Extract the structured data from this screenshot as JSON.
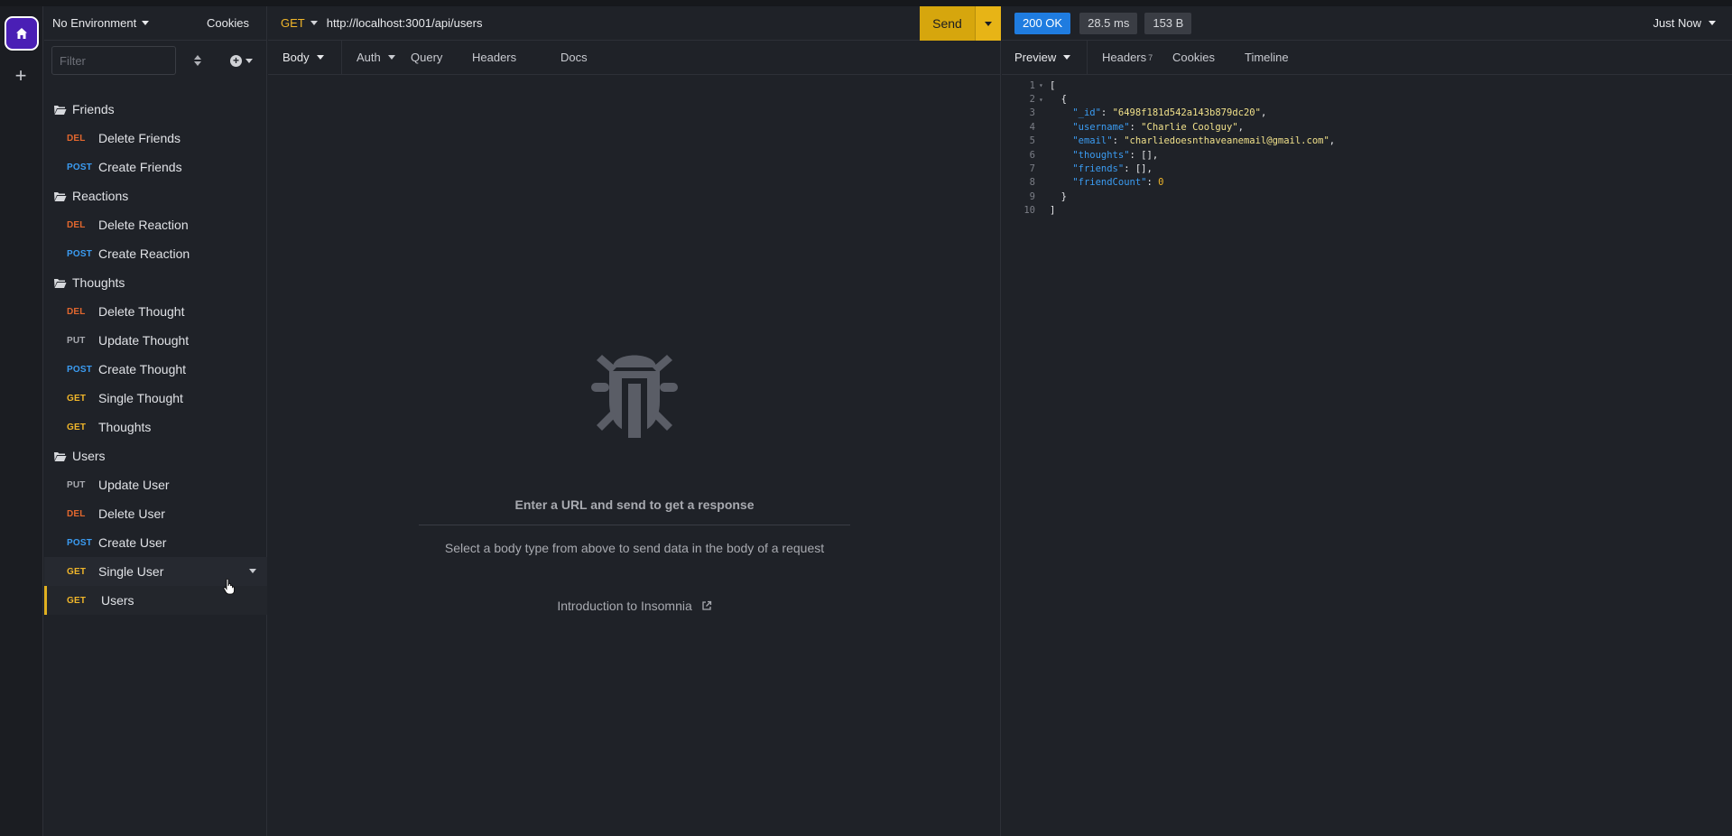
{
  "rail": {
    "home_icon": "home-icon",
    "add_label": "+"
  },
  "sidebar": {
    "environment": "No Environment",
    "cookies": "Cookies",
    "filter_placeholder": "Filter",
    "folders": [
      {
        "name": "Friends",
        "requests": [
          {
            "method": "DEL",
            "name": "Delete Friends"
          },
          {
            "method": "POST",
            "name": "Create Friends"
          }
        ]
      },
      {
        "name": "Reactions",
        "requests": [
          {
            "method": "DEL",
            "name": "Delete Reaction"
          },
          {
            "method": "POST",
            "name": "Create Reaction"
          }
        ]
      },
      {
        "name": "Thoughts",
        "requests": [
          {
            "method": "DEL",
            "name": "Delete Thought"
          },
          {
            "method": "PUT",
            "name": "Update Thought"
          },
          {
            "method": "POST",
            "name": "Create Thought"
          },
          {
            "method": "GET",
            "name": "Single Thought"
          },
          {
            "method": "GET",
            "name": "Thoughts"
          }
        ]
      },
      {
        "name": "Users",
        "requests": [
          {
            "method": "PUT",
            "name": "Update User"
          },
          {
            "method": "DEL",
            "name": "Delete User"
          },
          {
            "method": "POST",
            "name": "Create User"
          },
          {
            "method": "GET",
            "name": "Single User"
          },
          {
            "method": "GET",
            "name": "Users"
          }
        ]
      }
    ]
  },
  "request": {
    "method": "GET",
    "url": "http://localhost:3001/api/users",
    "send_label": "Send",
    "tabs": {
      "body": "Body",
      "auth": "Auth",
      "query": "Query",
      "headers": "Headers",
      "docs": "Docs"
    },
    "empty_title": "Enter a URL and send to get a response",
    "empty_sub": "Select a body type from above to send data in the body of a request",
    "intro_link": "Introduction to Insomnia"
  },
  "response": {
    "status": "200 OK",
    "time": "28.5 ms",
    "size": "153 B",
    "timestamp": "Just Now",
    "tabs": {
      "preview": "Preview",
      "headers": "Headers",
      "headers_count": "7",
      "cookies": "Cookies",
      "timeline": "Timeline"
    },
    "lines": [
      {
        "n": "1",
        "fold": "▾",
        "text": "["
      },
      {
        "n": "2",
        "fold": "▾",
        "text": "  {"
      },
      {
        "n": "3",
        "key": "\"_id\"",
        "value": "\"6498f181d542a143b879dc20\"",
        "vtype": "s",
        "tail": ","
      },
      {
        "n": "4",
        "key": "\"username\"",
        "value": "\"Charlie Coolguy\"",
        "vtype": "s",
        "tail": ","
      },
      {
        "n": "5",
        "key": "\"email\"",
        "value": "\"charliedoesnthaveanemail@gmail.com\"",
        "vtype": "s",
        "tail": ","
      },
      {
        "n": "6",
        "key": "\"thoughts\"",
        "value": "[]",
        "vtype": "p",
        "tail": ","
      },
      {
        "n": "7",
        "key": "\"friends\"",
        "value": "[]",
        "vtype": "p",
        "tail": ","
      },
      {
        "n": "8",
        "key": "\"friendCount\"",
        "value": "0",
        "vtype": "nmb",
        "tail": ""
      },
      {
        "n": "9",
        "fold": "",
        "text": "  }"
      },
      {
        "n": "10",
        "fold": "",
        "text": "]"
      }
    ]
  },
  "colors": {
    "accent": "#d6a60d",
    "status_ok": "#1f7ce0",
    "rail_home": "#4a1fb5"
  }
}
